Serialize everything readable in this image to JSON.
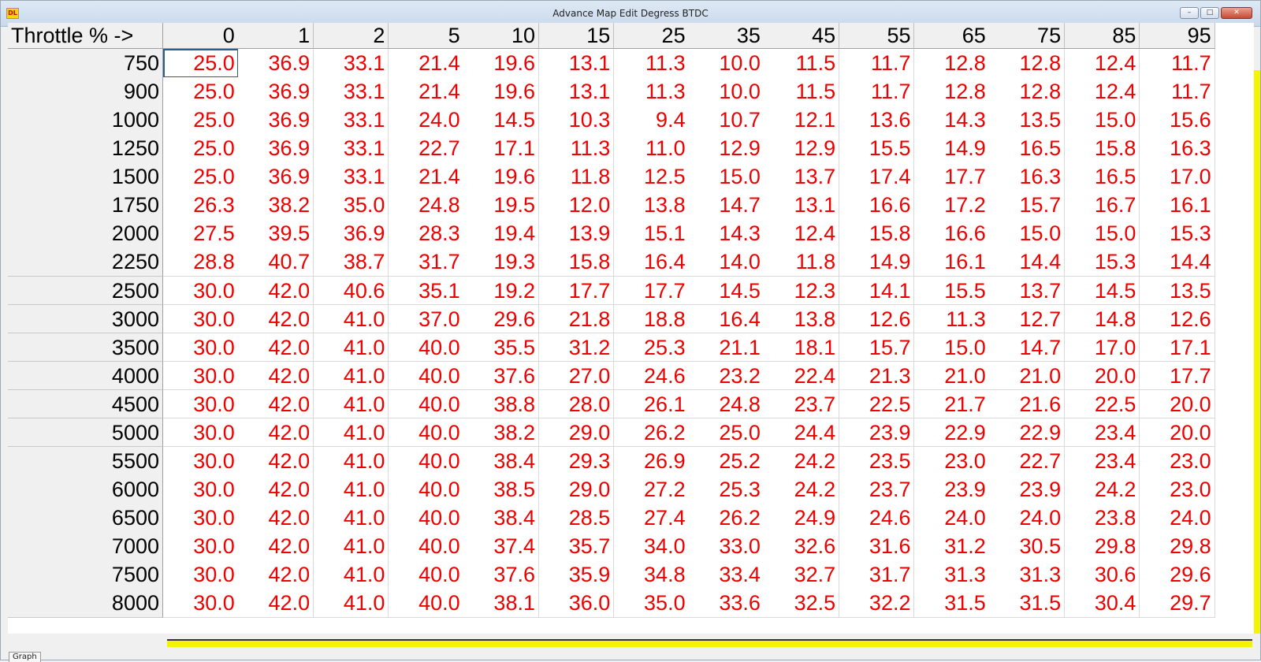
{
  "window": {
    "title": "Advance Map Edit Degress BTDC",
    "app_icon_label": "DL",
    "controls": {
      "minimize": "–",
      "maximize": "□",
      "close": "✕"
    }
  },
  "table": {
    "corner_label": "Throttle % ->",
    "columns": [
      "0",
      "1",
      "2",
      "5",
      "10",
      "15",
      "25",
      "35",
      "45",
      "55",
      "65",
      "75",
      "85",
      "95"
    ],
    "rows": [
      {
        "rpm": "750",
        "values": [
          "25.0",
          "36.9",
          "33.1",
          "21.4",
          "19.6",
          "13.1",
          "11.3",
          "10.0",
          "11.5",
          "11.7",
          "12.8",
          "12.8",
          "12.4",
          "11.7"
        ]
      },
      {
        "rpm": "900",
        "values": [
          "25.0",
          "36.9",
          "33.1",
          "21.4",
          "19.6",
          "13.1",
          "11.3",
          "10.0",
          "11.5",
          "11.7",
          "12.8",
          "12.8",
          "12.4",
          "11.7"
        ]
      },
      {
        "rpm": "1000",
        "values": [
          "25.0",
          "36.9",
          "33.1",
          "24.0",
          "14.5",
          "10.3",
          "9.4",
          "10.7",
          "12.1",
          "13.6",
          "14.3",
          "13.5",
          "15.0",
          "15.6"
        ]
      },
      {
        "rpm": "1250",
        "values": [
          "25.0",
          "36.9",
          "33.1",
          "22.7",
          "17.1",
          "11.3",
          "11.0",
          "12.9",
          "12.9",
          "15.5",
          "14.9",
          "16.5",
          "15.8",
          "16.3"
        ]
      },
      {
        "rpm": "1500",
        "values": [
          "25.0",
          "36.9",
          "33.1",
          "21.4",
          "19.6",
          "11.8",
          "12.5",
          "15.0",
          "13.7",
          "17.4",
          "17.7",
          "16.3",
          "16.5",
          "17.0"
        ]
      },
      {
        "rpm": "1750",
        "values": [
          "26.3",
          "38.2",
          "35.0",
          "24.8",
          "19.5",
          "12.0",
          "13.8",
          "14.7",
          "13.1",
          "16.6",
          "17.2",
          "15.7",
          "16.7",
          "16.1"
        ]
      },
      {
        "rpm": "2000",
        "values": [
          "27.5",
          "39.5",
          "36.9",
          "28.3",
          "19.4",
          "13.9",
          "15.1",
          "14.3",
          "12.4",
          "15.8",
          "16.6",
          "15.0",
          "15.0",
          "15.3"
        ]
      },
      {
        "rpm": "2250",
        "values": [
          "28.8",
          "40.7",
          "38.7",
          "31.7",
          "19.3",
          "15.8",
          "16.4",
          "14.0",
          "11.8",
          "14.9",
          "16.1",
          "14.4",
          "15.3",
          "14.4"
        ]
      },
      {
        "rpm": "2500",
        "values": [
          "30.0",
          "42.0",
          "40.6",
          "35.1",
          "19.2",
          "17.7",
          "17.7",
          "14.5",
          "12.3",
          "14.1",
          "15.5",
          "13.7",
          "14.5",
          "13.5"
        ]
      },
      {
        "rpm": "3000",
        "values": [
          "30.0",
          "42.0",
          "41.0",
          "37.0",
          "29.6",
          "21.8",
          "18.8",
          "16.4",
          "13.8",
          "12.6",
          "11.3",
          "12.7",
          "14.8",
          "12.6"
        ]
      },
      {
        "rpm": "3500",
        "values": [
          "30.0",
          "42.0",
          "41.0",
          "40.0",
          "35.5",
          "31.2",
          "25.3",
          "21.1",
          "18.1",
          "15.7",
          "15.0",
          "14.7",
          "17.0",
          "17.1"
        ]
      },
      {
        "rpm": "4000",
        "values": [
          "30.0",
          "42.0",
          "41.0",
          "40.0",
          "37.6",
          "27.0",
          "24.6",
          "23.2",
          "22.4",
          "21.3",
          "21.0",
          "21.0",
          "20.0",
          "17.7"
        ]
      },
      {
        "rpm": "4500",
        "values": [
          "30.0",
          "42.0",
          "41.0",
          "40.0",
          "38.8",
          "28.0",
          "26.1",
          "24.8",
          "23.7",
          "22.5",
          "21.7",
          "21.6",
          "22.5",
          "20.0"
        ]
      },
      {
        "rpm": "5000",
        "values": [
          "30.0",
          "42.0",
          "41.0",
          "40.0",
          "38.2",
          "29.0",
          "26.2",
          "25.0",
          "24.4",
          "23.9",
          "22.9",
          "22.9",
          "23.4",
          "20.0"
        ]
      },
      {
        "rpm": "5500",
        "values": [
          "30.0",
          "42.0",
          "41.0",
          "40.0",
          "38.4",
          "29.3",
          "26.9",
          "25.2",
          "24.2",
          "23.5",
          "23.0",
          "22.7",
          "23.4",
          "23.0"
        ]
      },
      {
        "rpm": "6000",
        "values": [
          "30.0",
          "42.0",
          "41.0",
          "40.0",
          "38.5",
          "29.0",
          "27.2",
          "25.3",
          "24.2",
          "23.7",
          "23.9",
          "23.9",
          "24.2",
          "23.0"
        ]
      },
      {
        "rpm": "6500",
        "values": [
          "30.0",
          "42.0",
          "41.0",
          "40.0",
          "38.4",
          "28.5",
          "27.4",
          "26.2",
          "24.9",
          "24.6",
          "24.0",
          "24.0",
          "23.8",
          "24.0"
        ]
      },
      {
        "rpm": "7000",
        "values": [
          "30.0",
          "42.0",
          "41.0",
          "40.0",
          "37.4",
          "35.7",
          "34.0",
          "33.0",
          "32.6",
          "31.6",
          "31.2",
          "30.5",
          "29.8",
          "29.8"
        ]
      },
      {
        "rpm": "7500",
        "values": [
          "30.0",
          "42.0",
          "41.0",
          "40.0",
          "37.6",
          "35.9",
          "34.8",
          "33.4",
          "32.7",
          "31.7",
          "31.3",
          "31.3",
          "30.6",
          "29.6"
        ]
      },
      {
        "rpm": "8000",
        "values": [
          "30.0",
          "42.0",
          "41.0",
          "40.0",
          "38.1",
          "36.0",
          "35.0",
          "33.6",
          "32.5",
          "32.2",
          "31.5",
          "31.5",
          "30.4",
          "29.7"
        ]
      }
    ]
  },
  "tabs": {
    "graph": "Graph"
  },
  "colors": {
    "value_text": "#ee0000",
    "scrollbar": "#f4f400",
    "header_bg": "#f0f0f0"
  }
}
